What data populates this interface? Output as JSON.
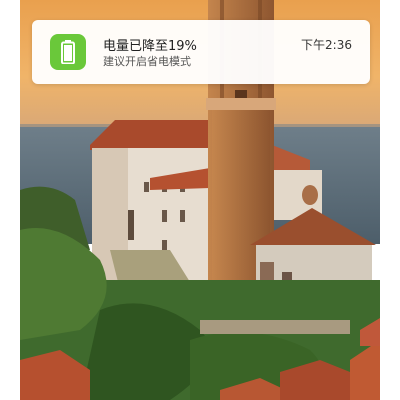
{
  "notification": {
    "app_icon": "battery-icon",
    "title": "电量已降至19%",
    "message": "建议开启省电模式",
    "time": "下午2:36",
    "accent_color": "#6ac83a",
    "battery_level_percent": 19
  },
  "wallpaper": {
    "description_icon": "landscape-photo"
  }
}
